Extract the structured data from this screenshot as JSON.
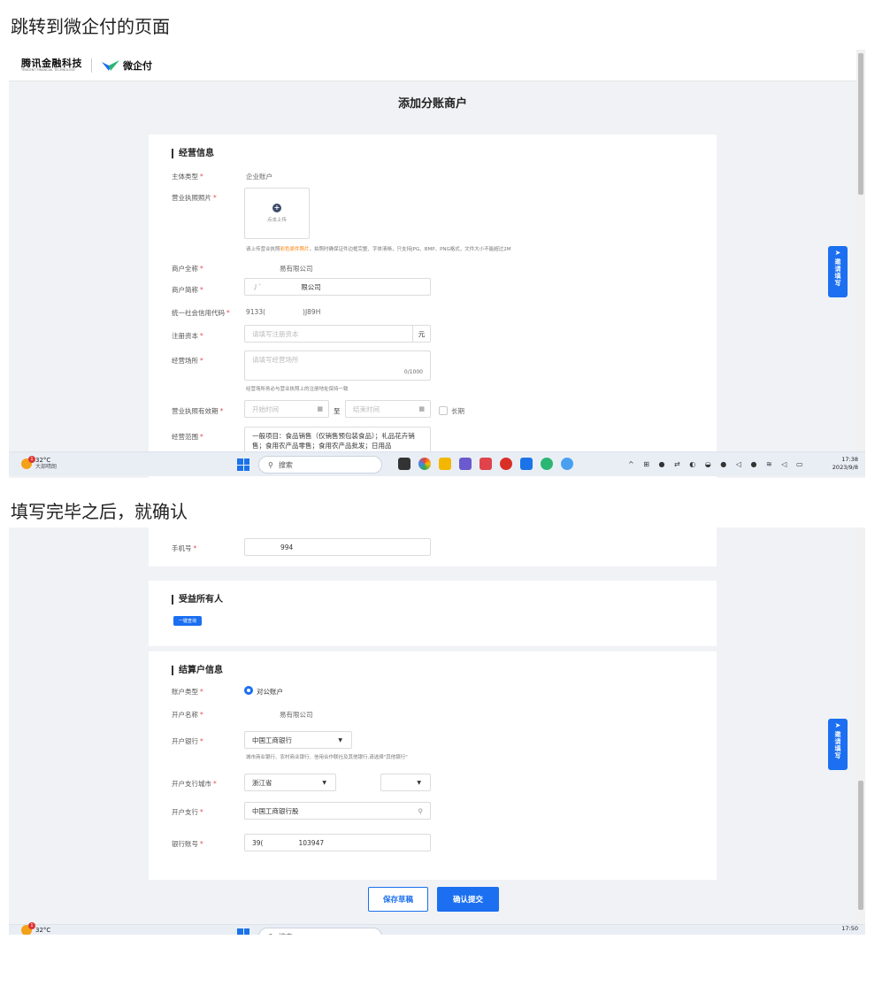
{
  "captions": {
    "first": "跳转到微企付的页面",
    "second": "填写完毕之后，就确认"
  },
  "header": {
    "brand_cn": "腾讯金融科技",
    "brand_en": "TENCENT FINANCIAL TECHNOLOGY",
    "product": "微企付"
  },
  "page": {
    "title": "添加分账商户"
  },
  "business": {
    "section_title": "经营信息",
    "entity_type": {
      "label": "主体类型",
      "value": "企业账户"
    },
    "license_photo": {
      "label": "营业执照照片",
      "upload_text": "点击上传"
    },
    "license_hint_pre": "请上传营业执照",
    "license_hint_orange": "彩色原件照片",
    "license_hint_post": "，拍照时确保证件边框完整、字体清晰，只支持JPG、BMP、PNG格式，文件大小不能超过2M",
    "full_name": {
      "label": "商户全称",
      "value": "易有限公司"
    },
    "short_name": {
      "label": "商户简称",
      "value": "限公司",
      "prefix": "丿ﾞ"
    },
    "credit_code": {
      "label": "统一社会信用代码",
      "value_a": "9133(",
      "value_b": ")J89H"
    },
    "capital": {
      "label": "注册资本",
      "placeholder": "请填写注册资本",
      "unit": "元"
    },
    "address": {
      "label": "经营场所",
      "placeholder": "请填写经营场所",
      "counter": "0/1000",
      "hint": "经营场所务必与营业执照上的注册地址保持一致"
    },
    "validity": {
      "label": "营业执照有效期",
      "start_placeholder": "开始时间",
      "sep": "至",
      "end_placeholder": "结束时间",
      "long_term": "长期"
    },
    "scope": {
      "label": "经营范围",
      "value": "一般项目：食品销售（仅销售预包装食品）；礼品花卉销售；食用农产品零售；食用农产品批发；日用品"
    }
  },
  "side_float": {
    "label": "邀请填写"
  },
  "taskbar1": {
    "temp": "32°C",
    "weather": "大部晴朗",
    "search": "搜索",
    "time": "17:38",
    "date": "2023/9/8"
  },
  "phone": {
    "label": "手机号",
    "value": "994"
  },
  "beneficiary": {
    "section_title": "受益所有人",
    "button": "一键查询"
  },
  "settlement": {
    "section_title": "结算户信息",
    "account_type": {
      "label": "账户类型",
      "value": "对公账户"
    },
    "account_name": {
      "label": "开户名称",
      "value": "易有限公司"
    },
    "bank": {
      "label": "开户银行",
      "value": "中国工商银行",
      "hint": "城市商业银行、农村商业银行、信用合作联社及其他银行,请选择\"其他银行\""
    },
    "branch_city": {
      "label": "开户支行城市",
      "province": "浙江省"
    },
    "branch": {
      "label": "开户支行",
      "value": "中国工商银行股"
    },
    "account_no": {
      "label": "银行账号",
      "value_a": "39(",
      "value_b": "103947"
    }
  },
  "actions": {
    "save_draft": "保存草稿",
    "submit": "确认提交"
  },
  "taskbar2": {
    "temp": "32°C",
    "search": "搜索",
    "time": "17:50"
  }
}
